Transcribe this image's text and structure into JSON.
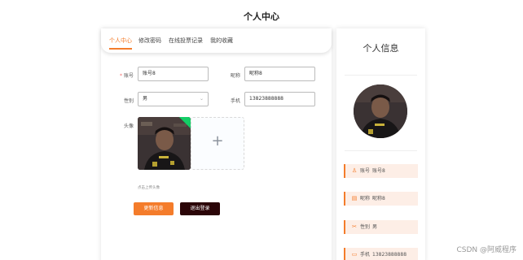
{
  "page_title": "个人中心",
  "tabs": [
    {
      "label": "个人中心",
      "active": true
    },
    {
      "label": "修改密码",
      "active": false
    },
    {
      "label": "在线投票记录",
      "active": false
    },
    {
      "label": "我的收藏",
      "active": false
    }
  ],
  "form": {
    "account_label": "账号",
    "account_value": "账号8",
    "nickname_label": "昵称",
    "nickname_value": "昵称8",
    "gender_label": "性别",
    "gender_value": "男",
    "phone_label": "手机",
    "phone_value": "13823888888",
    "avatar_label": "头像",
    "upload_plus": "+",
    "upload_tip": "点击上传头像",
    "select_arrow": "⌄"
  },
  "buttons": {
    "update": "更新信息",
    "logout": "退出登录"
  },
  "info_card": {
    "title": "个人信息",
    "items": [
      {
        "icon": "user-icon",
        "glyph": "♙",
        "label": "账号",
        "value": "账号8"
      },
      {
        "icon": "document-icon",
        "glyph": "▤",
        "label": "昵称",
        "value": "昵称8"
      },
      {
        "icon": "gender-icon",
        "glyph": "✂",
        "label": "性别",
        "value": "男"
      },
      {
        "icon": "phone-icon",
        "glyph": "▭",
        "label": "手机",
        "value": "13823888888"
      }
    ]
  },
  "watermark": "CSDN @阿威程序",
  "colors": {
    "accent": "#f47c2b",
    "logout_button": "#2b0508",
    "upload_success": "#13ce66",
    "info_item_bg": "#fdeee6"
  }
}
